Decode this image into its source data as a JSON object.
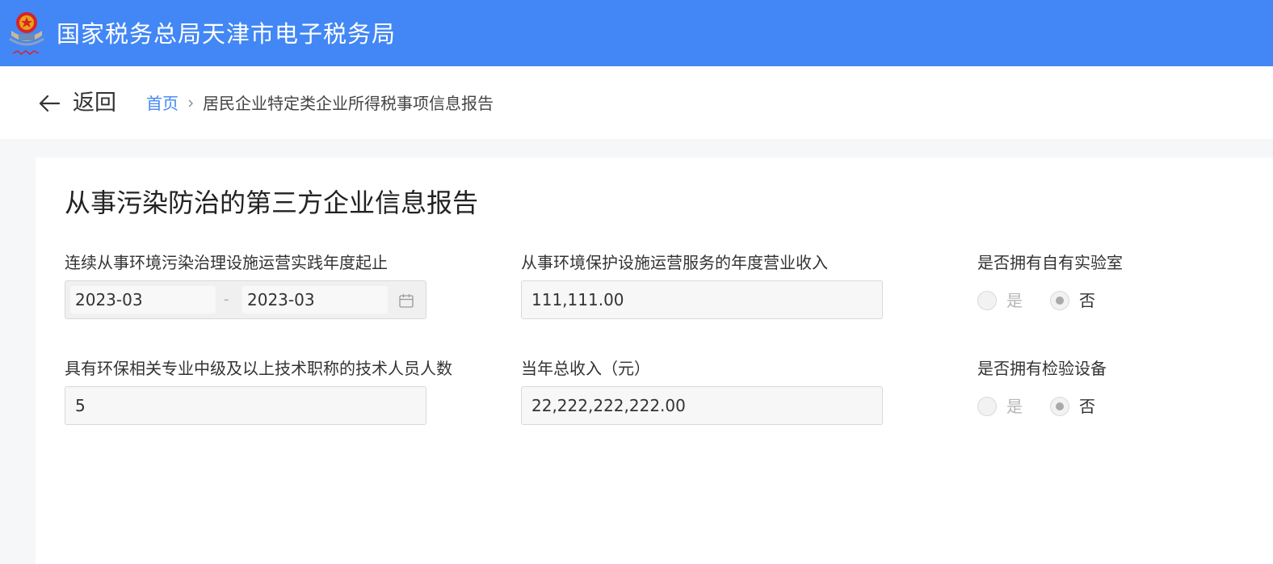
{
  "header": {
    "title": "国家税务总局天津市电子税务局",
    "brand_color": "#4287f5"
  },
  "nav": {
    "back_label": "返回",
    "breadcrumb": {
      "home": "首页",
      "current": "居民企业特定类企业所得税事项信息报告"
    }
  },
  "form": {
    "title": "从事污染防治的第三方企业信息报告",
    "fields": {
      "operation_period": {
        "label": "连续从事环境污染治理设施运营实践年度起止",
        "start": "2023-03",
        "separator": "-",
        "end": "2023-03"
      },
      "annual_service_revenue": {
        "label": "从事环境保护设施运营服务的年度营业收入",
        "value": "111,111.00"
      },
      "own_laboratory": {
        "label": "是否拥有自有实验室",
        "options": [
          "是",
          "否"
        ],
        "selected": "否"
      },
      "technical_staff_count": {
        "label": "具有环保相关专业中级及以上技术职称的技术人员人数",
        "value": "5"
      },
      "total_income": {
        "label": "当年总收入（元）",
        "value": "22,222,222,222.00"
      },
      "inspection_equipment": {
        "label": "是否拥有检验设备",
        "options": [
          "是",
          "否"
        ],
        "selected": "否"
      }
    }
  }
}
